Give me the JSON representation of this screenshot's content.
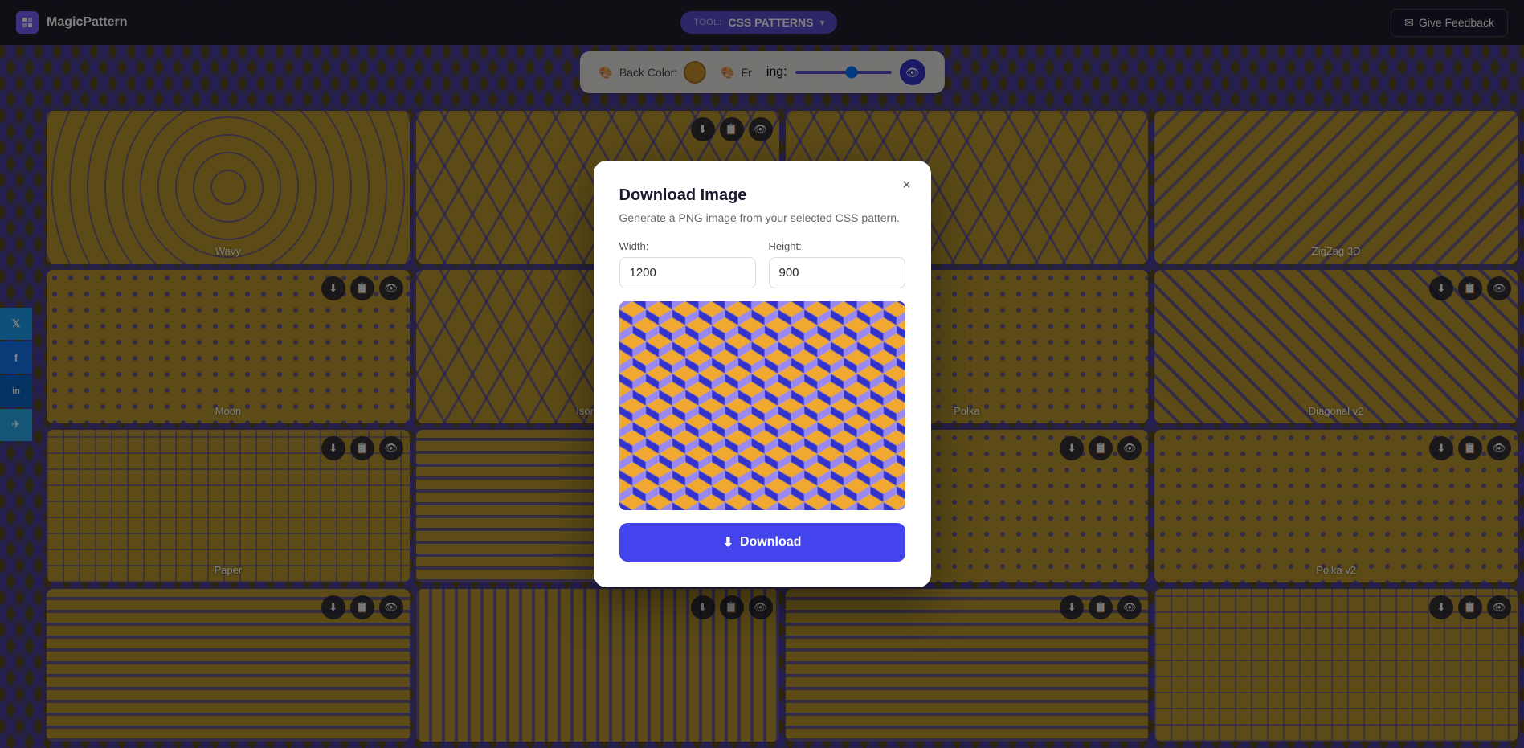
{
  "app": {
    "name": "MagicPattern",
    "logo_text": "MagicPattern"
  },
  "topbar": {
    "tool_label": "TOOL:",
    "tool_name": "CSS PATTERNS",
    "feedback_label": "Give Feedback",
    "feedback_icon": "✉"
  },
  "controls": {
    "back_color_label": "Back Color:",
    "front_color_label": "Fr",
    "spacing_label": "ing:",
    "back_color": "#c8912a",
    "front_color": "#4040aa"
  },
  "social": {
    "items": [
      {
        "name": "twitter",
        "icon": "𝕏"
      },
      {
        "name": "facebook",
        "icon": "f"
      },
      {
        "name": "linkedin",
        "icon": "in"
      },
      {
        "name": "telegram",
        "icon": "✈"
      }
    ]
  },
  "patterns": [
    {
      "name": "Wavy",
      "col": 0,
      "row": 0,
      "style": "wavy-bg"
    },
    {
      "name": "",
      "col": 1,
      "row": 0,
      "style": "isometric-bg"
    },
    {
      "name": "",
      "col": 2,
      "row": 0,
      "style": "isometric-bg"
    },
    {
      "name": "ZigZag 3D",
      "col": 3,
      "row": 0,
      "style": "zigzag-bg"
    },
    {
      "name": "Moon",
      "col": 0,
      "row": 1,
      "style": "polka-bg"
    },
    {
      "name": "Isometric",
      "col": 1,
      "row": 1,
      "style": "isometric-bg"
    },
    {
      "name": "Polka",
      "col": 2,
      "row": 1,
      "style": "polka-bg"
    },
    {
      "name": "Diagonal v2",
      "col": 3,
      "row": 1,
      "style": "diagonal-bg"
    },
    {
      "name": "Paper",
      "col": 0,
      "row": 2,
      "style": "grid-bg"
    },
    {
      "name": "",
      "col": 1,
      "row": 2,
      "style": "stripes-bg"
    },
    {
      "name": "",
      "col": 2,
      "row": 2,
      "style": "polka-bg"
    },
    {
      "name": "Polka v2",
      "col": 3,
      "row": 2,
      "style": "polka-bg"
    },
    {
      "name": "",
      "col": 0,
      "row": 3,
      "style": "stripes-bg"
    },
    {
      "name": "",
      "col": 1,
      "row": 3,
      "style": "stripes-bg"
    },
    {
      "name": "",
      "col": 2,
      "row": 3,
      "style": "stripes-bg"
    },
    {
      "name": "",
      "col": 3,
      "row": 3,
      "style": "grid-bg"
    }
  ],
  "modal": {
    "title": "Download Image",
    "subtitle": "Generate a PNG image from your selected CSS pattern.",
    "width_label": "Width:",
    "height_label": "Height:",
    "width_value": "1200",
    "height_value": "900",
    "download_label": "Download",
    "download_icon": "⬇",
    "close_icon": "×"
  }
}
